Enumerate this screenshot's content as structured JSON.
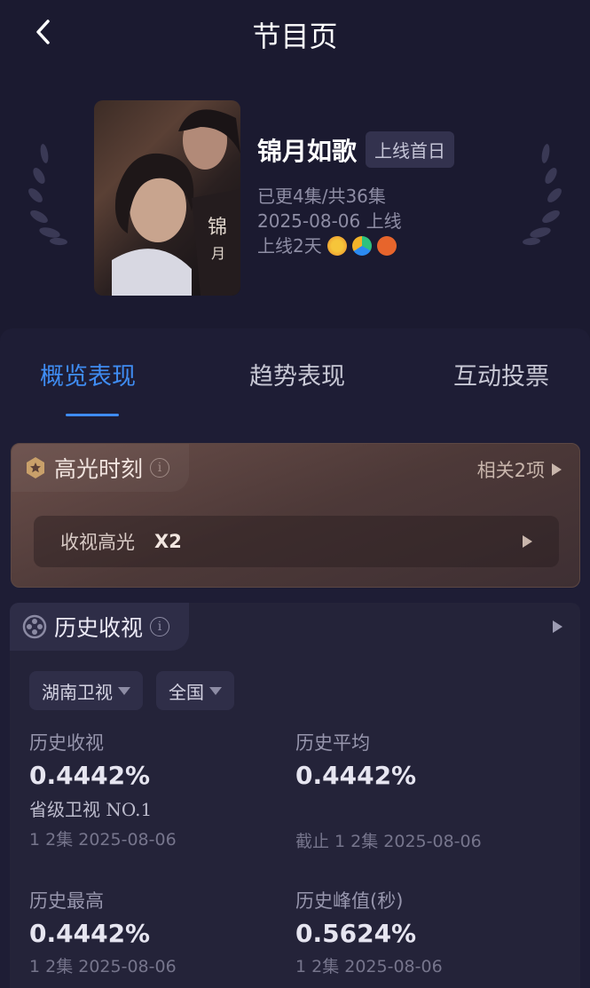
{
  "header": {
    "title": "节目页"
  },
  "show": {
    "title": "锦月如歌",
    "badge": "上线首日",
    "episodes": "已更4集/共36集",
    "release": "2025-08-06 上线",
    "days_online": "上线2天",
    "platform_icons": [
      "mango-tv-icon",
      "tencent-video-icon",
      "mgtv-icon"
    ]
  },
  "tabs": [
    {
      "label": "概览表现",
      "active": true
    },
    {
      "label": "趋势表现",
      "active": false
    },
    {
      "label": "互动投票",
      "active": false
    }
  ],
  "highlight": {
    "title": "高光时刻",
    "related": "相关2项",
    "row_label": "收视高光",
    "row_count": "X2"
  },
  "history": {
    "title": "历史收视",
    "filters": [
      "湖南卫视",
      "全国"
    ],
    "stats": [
      {
        "label": "历史收视",
        "value": "0.4442%",
        "rank": "省级卫视 NO.1",
        "sub": "1 2集 2025-08-06"
      },
      {
        "label": "历史平均",
        "value": "0.4442%",
        "rank": "",
        "sub": "截止 1 2集 2025-08-06"
      },
      {
        "label": "历史最高",
        "value": "0.4442%",
        "rank": "",
        "sub": "1 2集 2025-08-06"
      },
      {
        "label": "历史峰值(秒)",
        "value": "0.5624%",
        "rank": "",
        "sub": "1 2集 2025-08-06"
      }
    ]
  },
  "colors": {
    "accent": "#3f8cf2",
    "background": "#1b1a30",
    "highlight_card": "#5a4240"
  }
}
